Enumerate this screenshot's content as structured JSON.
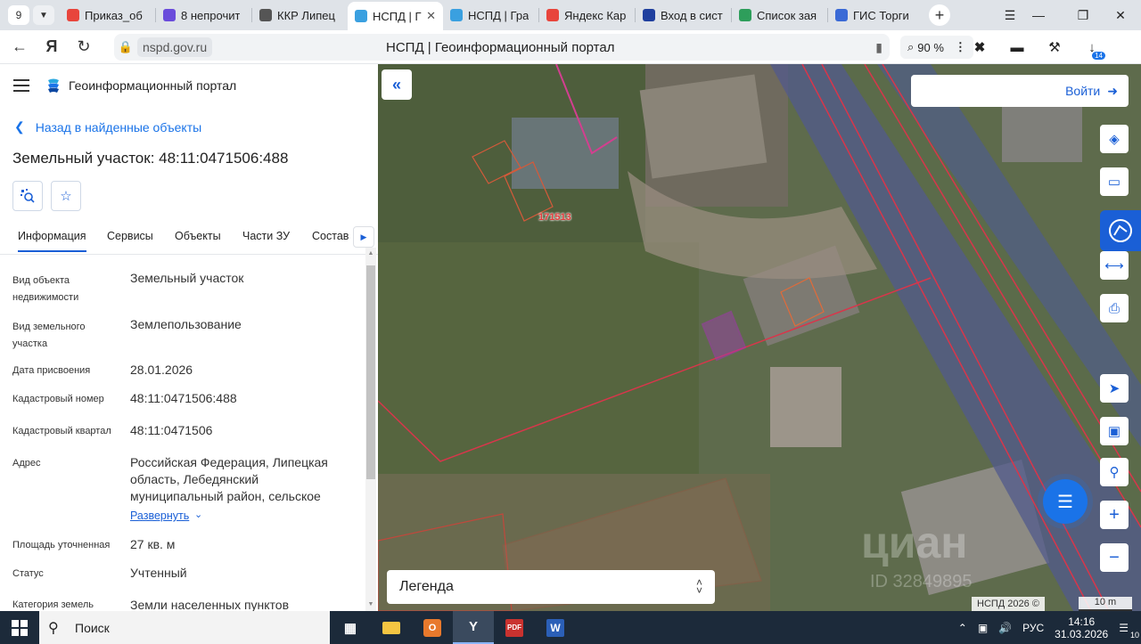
{
  "browser": {
    "tab_count": "9",
    "tabs": [
      {
        "title": "Приказ_об",
        "color": "#e8453c"
      },
      {
        "title": "8 непрочит",
        "color": "#6a4cdb"
      },
      {
        "title": "ККР Липец",
        "color": "#555555"
      },
      {
        "title": "НСПД | Г",
        "color": "#3aa0e0"
      },
      {
        "title": "НСПД | Гра",
        "color": "#3aa0e0"
      },
      {
        "title": "Яндекс Кар",
        "color": "#e8453c"
      },
      {
        "title": "Вход в сист",
        "color": "#1f3f9e"
      },
      {
        "title": "Список зая",
        "color": "#2e9e5b"
      },
      {
        "title": "ГИС Торги",
        "color": "#3a6ad6"
      }
    ],
    "active_tab_index": 3,
    "domain": "nspd.gov.ru",
    "page_title": "НСПД | Геоинформационный портал",
    "zoom": "90 %",
    "downloads_badge": "14"
  },
  "panel": {
    "portal_name": "Геоинформационный портал",
    "back_link": "Назад в найденные объекты",
    "title": "Земельный участок: 48:11:0471506:488",
    "tabs": [
      "Информация",
      "Сервисы",
      "Объекты",
      "Части ЗУ",
      "Состав"
    ],
    "properties": [
      {
        "label": "Вид объекта недвижимости",
        "value": "Земельный участок"
      },
      {
        "label": "Вид земельного участка",
        "value": "Землепользование"
      },
      {
        "label": "Дата присвоения",
        "value": "28.01.2026"
      },
      {
        "label": "Кадастровый номер",
        "value": "48:11:0471506:488"
      },
      {
        "label": "Кадастровый квартал",
        "value": "48:11:0471506"
      },
      {
        "label": "Адрес",
        "value": "Российская Федерация, Липецкая область, Лебедянский муниципальный район, сельское"
      },
      {
        "label": "Площадь уточненная",
        "value": "27 кв. м"
      },
      {
        "label": "Статус",
        "value": "Учтенный"
      },
      {
        "label": "Категория земель",
        "value": "Земли населенных пунктов"
      }
    ],
    "expand_label": "Развернуть"
  },
  "map": {
    "login_label": "Войти",
    "legend_label": "Легенда",
    "parcel_label": "171513",
    "watermark": "циан",
    "watermark_id": "ID 32849895",
    "copyright": "НСПД 2026 ©",
    "scale_label": "10 m",
    "accent_color": "#1a5fd6"
  },
  "taskbar": {
    "search_label": "Поиск",
    "language": "РУС",
    "time": "14:16",
    "date": "31.03.2026",
    "notifications": "10"
  }
}
